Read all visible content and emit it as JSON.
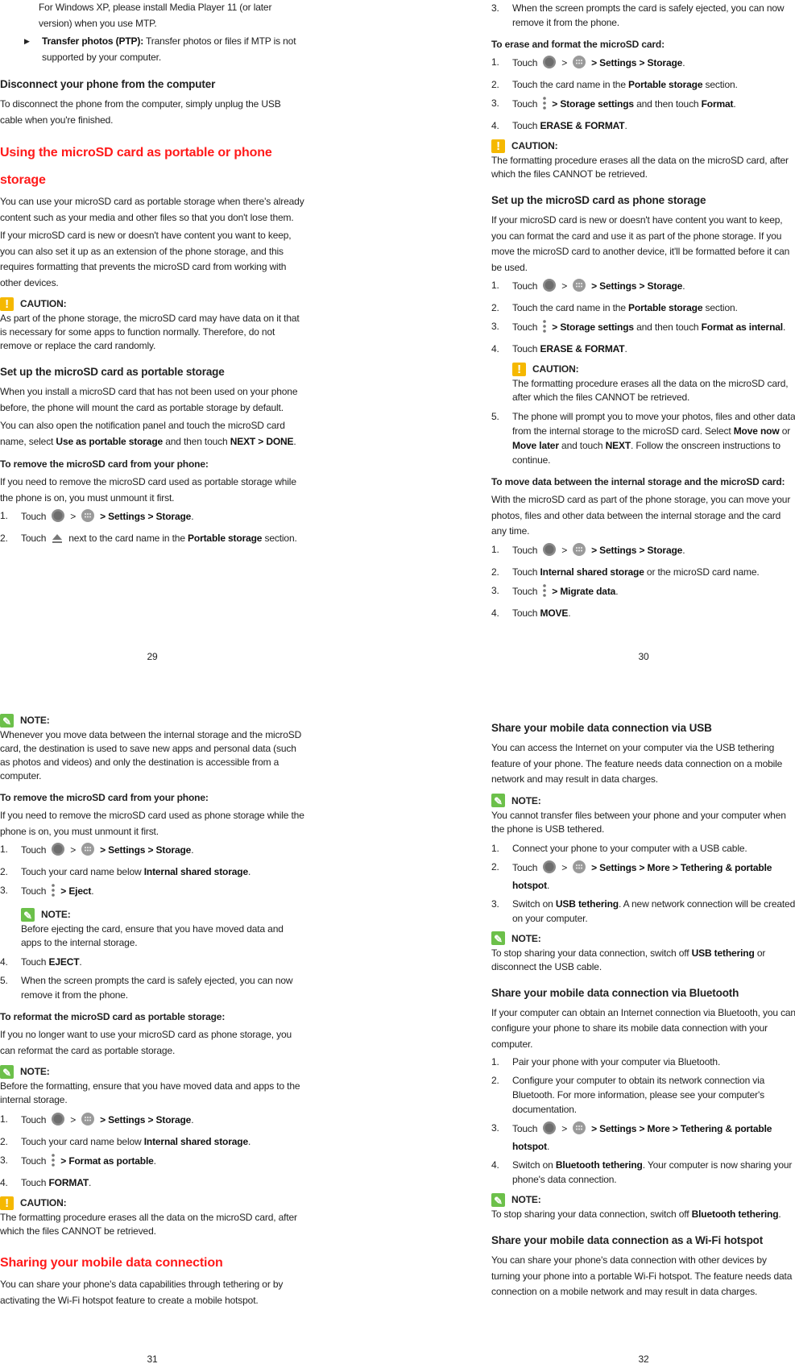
{
  "document": {
    "pages": [
      {
        "number": "29",
        "blocks": [
          {
            "type": "p",
            "indent": true,
            "t": [
              "For Windows XP, please install Media Player 11 (or later version) when you use MTP."
            ]
          },
          {
            "type": "bullet",
            "t": [
              {
                "b": "Transfer photos (PTP):"
              },
              " Transfer photos or files if MTP is not supported by your computer."
            ]
          },
          {
            "type": "h2",
            "t": [
              "Disconnect your phone from the computer"
            ]
          },
          {
            "type": "p",
            "t": [
              "To disconnect the phone from the computer, simply unplug the USB cable when you're finished."
            ]
          },
          {
            "type": "h1",
            "t": [
              "Using the microSD card as portable or phone storage"
            ]
          },
          {
            "type": "p",
            "t": [
              "You can use your microSD card as portable storage when there's already content such as your media and other files so that you don't lose them."
            ]
          },
          {
            "type": "p",
            "t": [
              "If your microSD card is new or doesn't have content you want to keep, you can also set it up as an extension of the phone storage, and this requires formatting that prevents the microSD card from working with other devices."
            ]
          },
          {
            "type": "caution",
            "label": "CAUTION:",
            "t": [
              "As part of the phone storage, the microSD card may have data on it that is necessary for some apps to function normally. Therefore, do not remove or replace the card randomly."
            ]
          },
          {
            "type": "h2",
            "t": [
              "Set up the microSD card as portable storage"
            ]
          },
          {
            "type": "p",
            "t": [
              "When you install a microSD card that has not been used on your phone before, the phone will mount the card as portable storage by default."
            ]
          },
          {
            "type": "p",
            "t": [
              "You can also open the notification panel and touch the microSD card name, select ",
              {
                "b": "Use as portable storage"
              },
              " and then touch ",
              {
                "b": "NEXT > DONE"
              },
              "."
            ]
          },
          {
            "type": "h3",
            "t": [
              "To remove the microSD card from your phone:"
            ]
          },
          {
            "type": "p",
            "t": [
              "If you need to remove the microSD card used as portable storage while the phone is on, you must unmount it first."
            ]
          },
          {
            "type": "li",
            "n": "1.",
            "t": [
              "Touch",
              {
                "i": "home"
              },
              ">",
              {
                "i": "apps"
              },
              {
                "b": "> Settings > Storage"
              },
              "."
            ]
          },
          {
            "type": "li",
            "n": "2.",
            "t": [
              "Touch",
              {
                "i": "eject"
              },
              "next to the card name in the ",
              {
                "b": "Portable storage"
              },
              " section."
            ]
          }
        ]
      },
      {
        "number": "30",
        "blocks": [
          {
            "type": "li",
            "n": "3.",
            "t": [
              "When the screen prompts the card is safely ejected, you can now remove it from the phone."
            ]
          },
          {
            "type": "h3",
            "t": [
              "To erase and format the microSD card:"
            ]
          },
          {
            "type": "li",
            "n": "1.",
            "t": [
              "Touch",
              {
                "i": "home"
              },
              ">",
              {
                "i": "apps"
              },
              {
                "b": "> Settings > Storage"
              },
              "."
            ]
          },
          {
            "type": "li",
            "n": "2.",
            "t": [
              "Touch the card name in the ",
              {
                "b": "Portable storage"
              },
              " section."
            ]
          },
          {
            "type": "li",
            "n": "3.",
            "t": [
              "Touch",
              {
                "i": "menu"
              },
              {
                "b": "> Storage settings"
              },
              " and then touch ",
              {
                "b": "Format"
              },
              "."
            ]
          },
          {
            "type": "li",
            "n": "4.",
            "t": [
              "Touch ",
              {
                "b": "ERASE & FORMAT"
              },
              "."
            ]
          },
          {
            "type": "caution",
            "label": "CAUTION:",
            "t": [
              "The formatting procedure erases all the data on the microSD card, after which the files CANNOT be retrieved."
            ]
          },
          {
            "type": "h2",
            "t": [
              "Set up the microSD card as phone storage"
            ]
          },
          {
            "type": "p",
            "t": [
              "If your microSD card is new or doesn't have content you want to keep, you can format the card and use it as part of the phone storage. If you move the microSD card to another device, it'll be formatted before it can be used."
            ]
          },
          {
            "type": "li",
            "n": "1.",
            "t": [
              "Touch",
              {
                "i": "home"
              },
              ">",
              {
                "i": "apps"
              },
              {
                "b": "> Settings > Storage"
              },
              "."
            ]
          },
          {
            "type": "li",
            "n": "2.",
            "t": [
              "Touch the card name in the ",
              {
                "b": "Portable storage"
              },
              " section."
            ]
          },
          {
            "type": "li",
            "n": "3.",
            "t": [
              "Touch",
              {
                "i": "menu"
              },
              {
                "b": "> Storage settings"
              },
              " and then touch ",
              {
                "b": "Format as internal"
              },
              "."
            ]
          },
          {
            "type": "li",
            "n": "4.",
            "t": [
              "Touch ",
              {
                "b": "ERASE & FORMAT"
              },
              "."
            ]
          },
          {
            "type": "caution",
            "indent": true,
            "label": "CAUTION:",
            "t": [
              "The formatting procedure erases all the data on the microSD card, after which the files CANNOT be retrieved."
            ]
          },
          {
            "type": "li",
            "n": "5.",
            "t": [
              "The phone will prompt you to move your photos, files and other data from the internal storage to the microSD card. Select ",
              {
                "b": "Move now"
              },
              " or ",
              {
                "b": "Move later"
              },
              " and touch ",
              {
                "b": "NEXT"
              },
              ". Follow the onscreen instructions to continue."
            ]
          },
          {
            "type": "h3",
            "t": [
              "To move data between the internal storage and the microSD card:"
            ]
          },
          {
            "type": "p",
            "t": [
              "With the microSD card as part of the phone storage, you can move your photos, files and other data between the internal storage and the card any time."
            ]
          },
          {
            "type": "li",
            "n": "1.",
            "t": [
              "Touch",
              {
                "i": "home"
              },
              ">",
              {
                "i": "apps"
              },
              {
                "b": "> Settings > Storage"
              },
              "."
            ]
          },
          {
            "type": "li",
            "n": "2.",
            "t": [
              "Touch ",
              {
                "b": "Internal shared storage"
              },
              " or the microSD card name."
            ]
          },
          {
            "type": "li",
            "n": "3.",
            "t": [
              "Touch",
              {
                "i": "menu"
              },
              {
                "b": "> Migrate data"
              },
              "."
            ]
          },
          {
            "type": "li",
            "n": "4.",
            "t": [
              "Touch ",
              {
                "b": "MOVE"
              },
              "."
            ]
          }
        ]
      },
      {
        "number": "31",
        "blocks": [
          {
            "type": "note",
            "label": "NOTE:",
            "t": [
              "Whenever you move data between the internal storage and the microSD card, the destination is used to save new apps and personal data (such as photos and videos) and only the destination is accessible from a computer."
            ]
          },
          {
            "type": "h3",
            "t": [
              "To remove the microSD card from your phone:"
            ]
          },
          {
            "type": "p",
            "t": [
              "If you need to remove the microSD card used as phone storage while the phone is on, you must unmount it first."
            ]
          },
          {
            "type": "li",
            "n": "1.",
            "t": [
              "Touch",
              {
                "i": "home"
              },
              ">",
              {
                "i": "apps"
              },
              {
                "b": "> Settings > Storage"
              },
              "."
            ]
          },
          {
            "type": "li",
            "n": "2.",
            "t": [
              "Touch your card name below ",
              {
                "b": "Internal shared storage"
              },
              "."
            ]
          },
          {
            "type": "li",
            "n": "3.",
            "t": [
              "Touch",
              {
                "i": "menu"
              },
              {
                "b": "> Eject"
              },
              "."
            ]
          },
          {
            "type": "note",
            "indent": true,
            "label": "NOTE:",
            "t": [
              "Before ejecting the card, ensure that you have moved data and apps to the internal storage."
            ]
          },
          {
            "type": "li",
            "n": "4.",
            "t": [
              "Touch ",
              {
                "b": "EJECT"
              },
              "."
            ]
          },
          {
            "type": "li",
            "n": "5.",
            "t": [
              "When the screen prompts the card is safely ejected, you can now remove it from the phone."
            ]
          },
          {
            "type": "h3",
            "t": [
              "To reformat the microSD card as portable storage:"
            ]
          },
          {
            "type": "p",
            "t": [
              "If you no longer want to use your microSD card as phone storage, you can reformat the card as portable storage."
            ]
          },
          {
            "type": "note",
            "label": "NOTE:",
            "t": [
              "Before the formatting, ensure that you have moved data and apps to the internal storage."
            ]
          },
          {
            "type": "li",
            "n": "1.",
            "t": [
              "Touch",
              {
                "i": "home"
              },
              ">",
              {
                "i": "apps"
              },
              {
                "b": "> Settings > Storage"
              },
              "."
            ]
          },
          {
            "type": "li",
            "n": "2.",
            "t": [
              "Touch your card name below ",
              {
                "b": "Internal shared storage"
              },
              "."
            ]
          },
          {
            "type": "li",
            "n": "3.",
            "t": [
              "Touch",
              {
                "i": "menu"
              },
              {
                "b": "> Format as portable"
              },
              "."
            ]
          },
          {
            "type": "li",
            "n": "4.",
            "t": [
              "Touch ",
              {
                "b": "FORMAT"
              },
              "."
            ]
          },
          {
            "type": "caution",
            "label": "CAUTION:",
            "t": [
              "The formatting procedure erases all the data on the microSD card, after which the files CANNOT be retrieved."
            ]
          },
          {
            "type": "h1",
            "t": [
              "Sharing your mobile data connection"
            ]
          },
          {
            "type": "p",
            "t": [
              "You can share your phone's data capabilities through tethering or by activating the Wi-Fi hotspot feature to create a mobile hotspot."
            ]
          }
        ]
      },
      {
        "number": "32",
        "blocks": [
          {
            "type": "h2",
            "t": [
              "Share your mobile data connection via USB"
            ]
          },
          {
            "type": "p",
            "t": [
              "You can access the Internet on your computer via the USB tethering feature of your phone. The feature needs data connection on a mobile network and may result in data charges."
            ]
          },
          {
            "type": "note",
            "label": "NOTE:",
            "t": [
              "You cannot transfer files between your phone and your computer when the phone is USB tethered."
            ]
          },
          {
            "type": "li",
            "n": "1.",
            "t": [
              "Connect your phone to your computer with a USB cable."
            ]
          },
          {
            "type": "li",
            "n": "2.",
            "t": [
              "Touch",
              {
                "i": "home"
              },
              ">",
              {
                "i": "apps"
              },
              {
                "b": "> Settings > More > Tethering & portable hotspot"
              },
              "."
            ]
          },
          {
            "type": "li",
            "n": "3.",
            "t": [
              "Switch on ",
              {
                "b": "USB tethering"
              },
              ". A new network connection will be created on your computer."
            ]
          },
          {
            "type": "note",
            "label": "NOTE:",
            "t": [
              "To stop sharing your data connection, switch off ",
              {
                "b": "USB tethering"
              },
              " or disconnect the USB cable."
            ]
          },
          {
            "type": "h2",
            "t": [
              "Share your mobile data connection via Bluetooth"
            ]
          },
          {
            "type": "p",
            "t": [
              "If your computer can obtain an Internet connection via Bluetooth, you can configure your phone to share its mobile data connection with your computer."
            ]
          },
          {
            "type": "li",
            "n": "1.",
            "t": [
              "Pair your phone with your computer via Bluetooth."
            ]
          },
          {
            "type": "li",
            "n": "2.",
            "t": [
              "Configure your computer to obtain its network connection via Bluetooth. For more information, please see your computer's documentation."
            ]
          },
          {
            "type": "li",
            "n": "3.",
            "t": [
              "Touch",
              {
                "i": "home"
              },
              ">",
              {
                "i": "apps"
              },
              {
                "b": "> Settings > More > Tethering & portable hotspot"
              },
              "."
            ]
          },
          {
            "type": "li",
            "n": "4.",
            "t": [
              "Switch on ",
              {
                "b": "Bluetooth tethering"
              },
              ". Your computer is now sharing your phone's data connection."
            ]
          },
          {
            "type": "note",
            "label": "NOTE:",
            "t": [
              "To stop sharing your data connection, switch off ",
              {
                "b": "Bluetooth tethering"
              },
              "."
            ]
          },
          {
            "type": "h2",
            "t": [
              "Share your mobile data connection as a Wi-Fi hotspot"
            ]
          },
          {
            "type": "p",
            "t": [
              "You can share your phone's data connection with other devices by turning your phone into a portable Wi-Fi hotspot. The feature needs data connection on a mobile network and may result in data charges."
            ]
          }
        ]
      }
    ]
  },
  "colors": {
    "heading_red": "#ff1a1a",
    "caution": "#f5b800",
    "note": "#6cc04a"
  },
  "icons": {
    "home": "home-circle-icon",
    "apps": "apps-grid-icon",
    "menu": "more-vertical-icon",
    "eject": "eject-icon",
    "caution": "caution-icon",
    "note": "note-pencil-icon"
  }
}
